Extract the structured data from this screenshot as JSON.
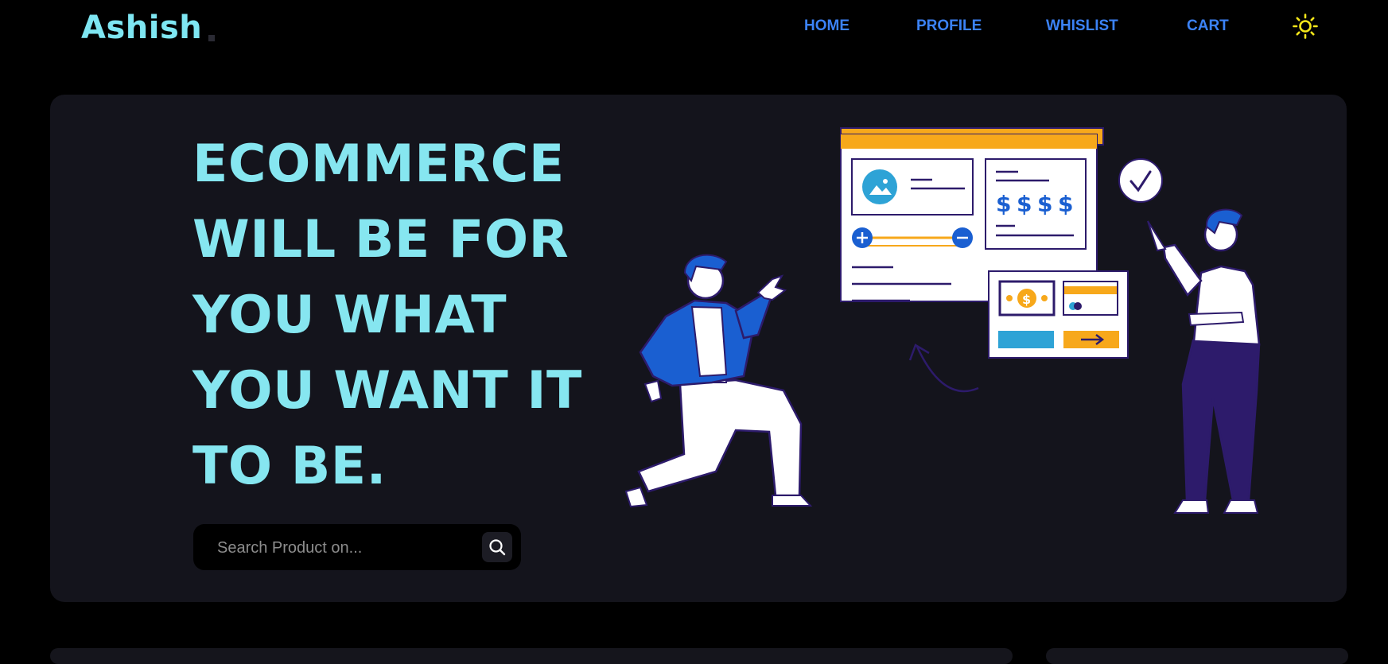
{
  "brand": {
    "name": "Ashish"
  },
  "nav": {
    "items": [
      {
        "label": "HOME"
      },
      {
        "label": "PROFILE"
      },
      {
        "label": "WHISLIST"
      },
      {
        "label": "CART"
      }
    ],
    "theme_toggle_icon": "sun-icon"
  },
  "hero": {
    "headline_lines": [
      "ECOMMERCE",
      "WILL BE FOR",
      "YOU WHAT",
      "YOU WANT IT",
      "TO BE."
    ],
    "search": {
      "placeholder": "Search Product on...",
      "value": "",
      "button_icon": "search-icon"
    },
    "illustration": {
      "price_symbols": [
        "$",
        "$",
        "$",
        "$"
      ],
      "coin_symbol": "$"
    }
  },
  "colors": {
    "background": "#000000",
    "hero_card": "#14141c",
    "logo_accent": "#7ee6f2",
    "headline": "#86e6f0",
    "nav_link": "#3b82f6",
    "sun": "#f5e61a",
    "illustration_orange": "#f7a81b",
    "illustration_blue": "#1a5fd1",
    "illustration_purple": "#2d1b6b"
  }
}
